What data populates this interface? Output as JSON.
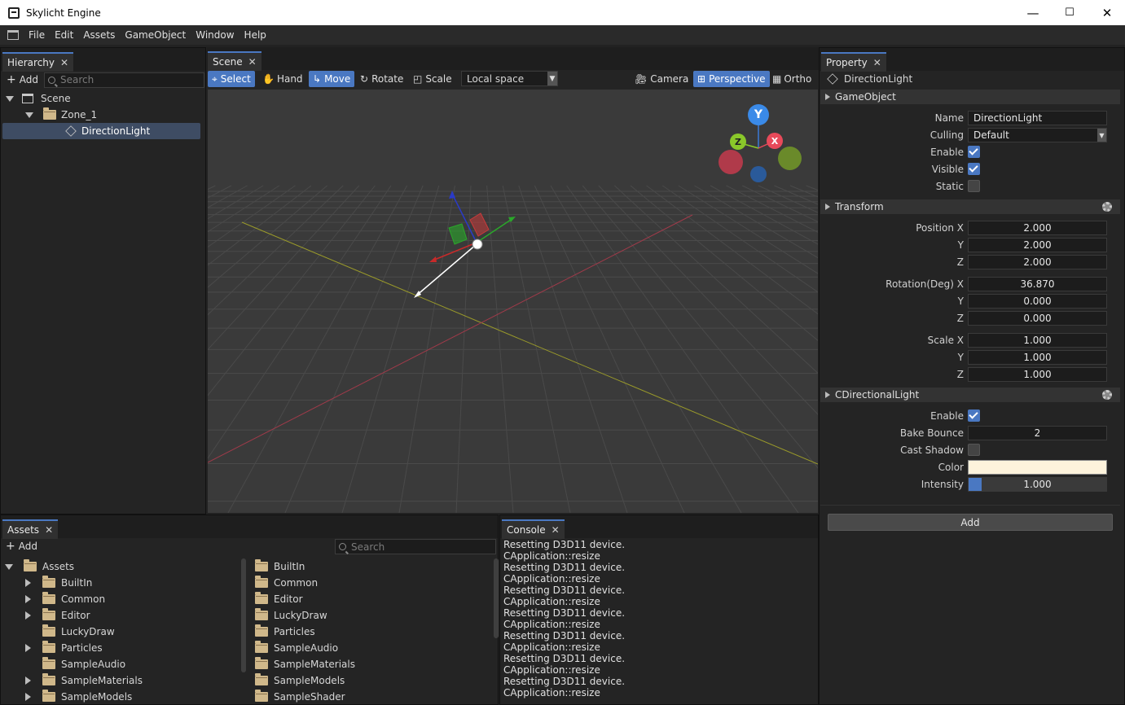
{
  "window": {
    "title": "Skylicht Engine",
    "minimize": "—",
    "maximize": "☐",
    "close": "✕"
  },
  "menu": [
    "File",
    "Edit",
    "Assets",
    "GameObject",
    "Window",
    "Help"
  ],
  "hierarchy": {
    "tab": "Hierarchy",
    "add": "Add",
    "search_placeholder": "Search",
    "items": [
      {
        "label": "Scene",
        "icon": "scene-icon"
      },
      {
        "label": "Zone_1",
        "icon": "folder-icon"
      },
      {
        "label": "DirectionLight",
        "icon": "cube-icon",
        "selected": true
      }
    ]
  },
  "scene": {
    "tab": "Scene",
    "tools": {
      "select": "Select",
      "hand": "Hand",
      "move": "Move",
      "rotate": "Rotate",
      "scale": "Scale"
    },
    "space": "Local space",
    "camera": "Camera",
    "perspective": "Perspective",
    "ortho": "Ortho",
    "gizmo": {
      "y": "Y",
      "z": "Z",
      "x": "X"
    }
  },
  "property": {
    "tab": "Property",
    "object_name": "DirectionLight",
    "gameobject": {
      "header": "GameObject",
      "name_label": "Name",
      "name_value": "DirectionLight",
      "culling_label": "Culling",
      "culling_value": "Default",
      "enable_label": "Enable",
      "visible_label": "Visible",
      "static_label": "Static"
    },
    "transform": {
      "header": "Transform",
      "position_label": "Position X",
      "pos_x": "2.000",
      "pos_y": "2.000",
      "pos_z": "2.000",
      "rotation_label": "Rotation(Deg) X",
      "rot_x": "36.870",
      "rot_y": "0.000",
      "rot_z": "0.000",
      "scale_label": "Scale X",
      "scale_x": "1.000",
      "scale_y": "1.000",
      "scale_z": "1.000",
      "y": "Y",
      "z": "Z"
    },
    "light": {
      "header": "CDirectionalLight",
      "enable_label": "Enable",
      "bake_label": "Bake Bounce",
      "bake_value": "2",
      "shadow_label": "Cast Shadow",
      "color_label": "Color",
      "color_hex": "#fdf3dc",
      "intensity_label": "Intensity",
      "intensity_value": "1.000"
    },
    "add_button": "Add"
  },
  "assets": {
    "tab": "Assets",
    "add": "Add",
    "search_placeholder": "Search",
    "tree": [
      "Assets",
      "BuiltIn",
      "Common",
      "Editor",
      "LuckyDraw",
      "Particles",
      "SampleAudio",
      "SampleMaterials",
      "SampleModels"
    ],
    "list": [
      "BuiltIn",
      "Common",
      "Editor",
      "LuckyDraw",
      "Particles",
      "SampleAudio",
      "SampleMaterials",
      "SampleModels",
      "SampleShader"
    ]
  },
  "console": {
    "tab": "Console",
    "lines": [
      "Resetting D3D11 device.",
      "CApplication::resize",
      "Resetting D3D11 device.",
      "CApplication::resize",
      "Resetting D3D11 device.",
      "CApplication::resize",
      "Resetting D3D11 device.",
      "CApplication::resize",
      "Resetting D3D11 device.",
      "CApplication::resize",
      "Resetting D3D11 device.",
      "CApplication::resize",
      "Resetting D3D11 device.",
      "CApplication::resize"
    ]
  },
  "colors": {
    "accent": "#4a78c2",
    "panel": "#242424",
    "viewport": "#3a3a3a"
  }
}
